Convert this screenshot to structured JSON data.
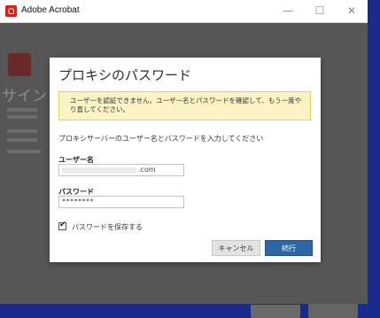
{
  "window": {
    "title": "Adobe Acrobat",
    "minimize_glyph": "—",
    "maximize_glyph": "☐",
    "close_glyph": "✕"
  },
  "background": {
    "heading": "サイン"
  },
  "dialog": {
    "title": "プロキシのパスワード",
    "warning": "ユーザーを認証できません。ユーザー名とパスワードを確認して、もう一度やり直してください。",
    "instruction": "プロキシサーバーのユーザー名とパスワードを入力してください",
    "username_label": "ユーザー名",
    "username_value_suffix": ".com",
    "password_label": "パスワード",
    "password_value": "********",
    "remember_label": "パスワードを保存する",
    "remember_checked": true,
    "cancel_label": "キャンセル",
    "continue_label": "続行"
  },
  "colors": {
    "primary_button": "#2c66a5",
    "warning_bg": "#fbf3c3",
    "desktop": "#1b2a8f"
  }
}
